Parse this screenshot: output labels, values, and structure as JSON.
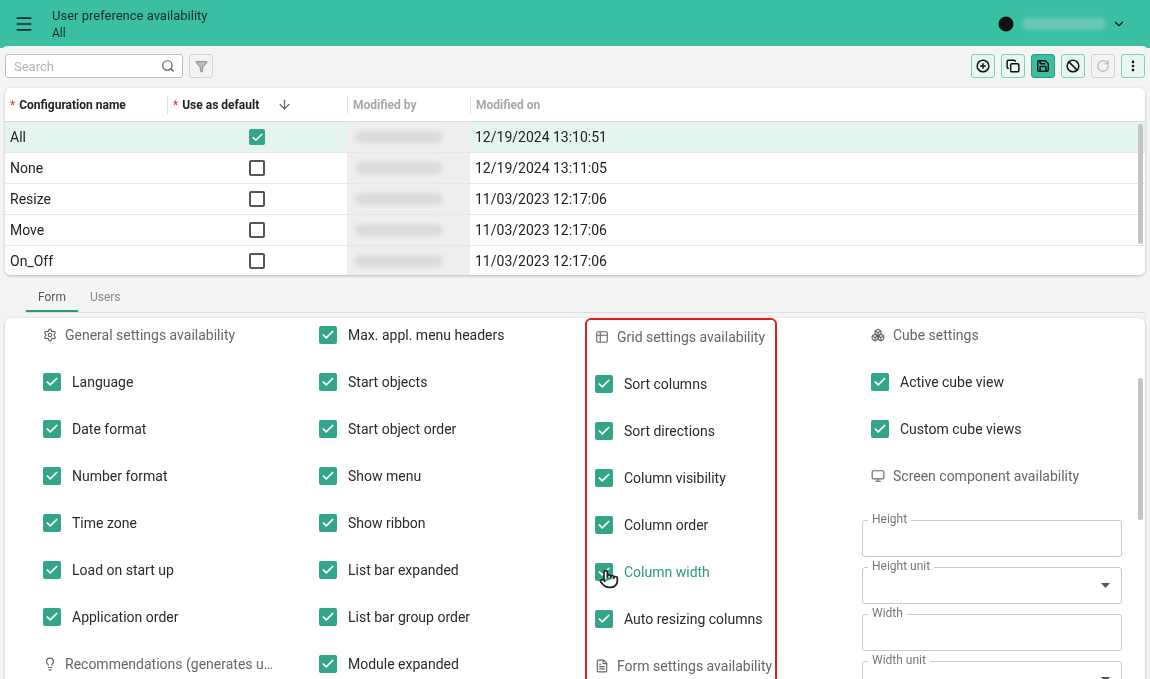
{
  "header": {
    "title": "User preference availability",
    "subtitle": "All"
  },
  "search": {
    "placeholder": "Search"
  },
  "filter_button": {
    "disabled": true
  },
  "toolbar": [
    {
      "kind": "add",
      "primary": false,
      "disabled": false
    },
    {
      "kind": "copy",
      "primary": false,
      "disabled": false
    },
    {
      "kind": "save",
      "primary": true,
      "disabled": false
    },
    {
      "kind": "cancel",
      "primary": false,
      "disabled": false
    },
    {
      "kind": "refresh",
      "primary": false,
      "disabled": true
    },
    {
      "kind": "more",
      "primary": false,
      "disabled": false
    }
  ],
  "table": {
    "columns": [
      {
        "required_mark": "*",
        "label": "Configuration name",
        "sorted": false,
        "disabled": false
      },
      {
        "required_mark": "*",
        "label": "Use as default",
        "sorted": true,
        "disabled": false
      },
      {
        "label": "Modified by",
        "sorted": false,
        "disabled": true
      },
      {
        "label": "Modified on",
        "sorted": false,
        "disabled": true
      }
    ],
    "rows": [
      {
        "name": "All",
        "default": true,
        "modified_on": "12/19/2024 13:10:51",
        "selected": true
      },
      {
        "name": "None",
        "default": false,
        "modified_on": "12/19/2024 13:11:05",
        "selected": false
      },
      {
        "name": "Resize",
        "default": false,
        "modified_on": "11/03/2023 12:17:06",
        "selected": false
      },
      {
        "name": "Move",
        "default": false,
        "modified_on": "11/03/2023 12:17:06",
        "selected": false
      },
      {
        "name": "On_Off",
        "default": false,
        "modified_on": "11/03/2023 12:17:06",
        "selected": false
      }
    ]
  },
  "tabs": [
    {
      "label": "Form",
      "selected": true
    },
    {
      "label": "Users",
      "selected": false
    }
  ],
  "form": {
    "columns": [
      {
        "highlighted": false,
        "items": [
          {
            "kind": "heading",
            "label": "General settings availability"
          },
          {
            "kind": "checkbox",
            "label": "Language",
            "checked": true,
            "hovered": false
          },
          {
            "kind": "checkbox",
            "label": "Date format",
            "checked": true,
            "hovered": false
          },
          {
            "kind": "checkbox",
            "label": "Number format",
            "checked": true,
            "hovered": false
          },
          {
            "kind": "checkbox",
            "label": "Time zone",
            "checked": true,
            "hovered": false
          },
          {
            "kind": "checkbox",
            "label": "Load on start up",
            "checked": true,
            "hovered": false
          },
          {
            "kind": "checkbox",
            "label": "Application order",
            "checked": true,
            "hovered": false
          },
          {
            "kind": "heading",
            "label": "Recommendations (generates u…"
          }
        ]
      },
      {
        "highlighted": false,
        "items": [
          {
            "kind": "checkbox",
            "label": "Max. appl. menu headers",
            "checked": true,
            "hovered": false
          },
          {
            "kind": "checkbox",
            "label": "Start objects",
            "checked": true,
            "hovered": false
          },
          {
            "kind": "checkbox",
            "label": "Start object order",
            "checked": true,
            "hovered": false
          },
          {
            "kind": "checkbox",
            "label": "Show menu",
            "checked": true,
            "hovered": false
          },
          {
            "kind": "checkbox",
            "label": "Show ribbon",
            "checked": true,
            "hovered": false
          },
          {
            "kind": "checkbox",
            "label": "List bar expanded",
            "checked": true,
            "hovered": false
          },
          {
            "kind": "checkbox",
            "label": "List bar group order",
            "checked": true,
            "hovered": false
          },
          {
            "kind": "checkbox",
            "label": "Module expanded",
            "checked": true,
            "hovered": false
          }
        ]
      },
      {
        "highlighted": true,
        "items": [
          {
            "kind": "heading",
            "label": "Grid settings availability"
          },
          {
            "kind": "checkbox",
            "label": "Sort columns",
            "checked": true,
            "hovered": false
          },
          {
            "kind": "checkbox",
            "label": "Sort directions",
            "checked": true,
            "hovered": false
          },
          {
            "kind": "checkbox",
            "label": "Column visibility",
            "checked": true,
            "hovered": false
          },
          {
            "kind": "checkbox",
            "label": "Column order",
            "checked": true,
            "hovered": false
          },
          {
            "kind": "checkbox",
            "label": "Column width",
            "checked": true,
            "hovered": true
          },
          {
            "kind": "checkbox",
            "label": "Auto resizing columns",
            "checked": true,
            "hovered": false
          },
          {
            "kind": "heading",
            "label": "Form settings availability"
          }
        ]
      },
      {
        "highlighted": false,
        "items": [
          {
            "kind": "heading",
            "label": "Cube settings"
          },
          {
            "kind": "checkbox",
            "label": "Active cube view",
            "checked": true,
            "hovered": false
          },
          {
            "kind": "checkbox",
            "label": "Custom cube views",
            "checked": true,
            "hovered": false
          },
          {
            "kind": "heading",
            "label": "Screen component availability"
          },
          {
            "kind": "field",
            "label": "Height"
          },
          {
            "kind": "select",
            "label": "Height unit"
          },
          {
            "kind": "field",
            "label": "Width"
          },
          {
            "kind": "select",
            "label": "Width unit"
          }
        ]
      }
    ]
  }
}
